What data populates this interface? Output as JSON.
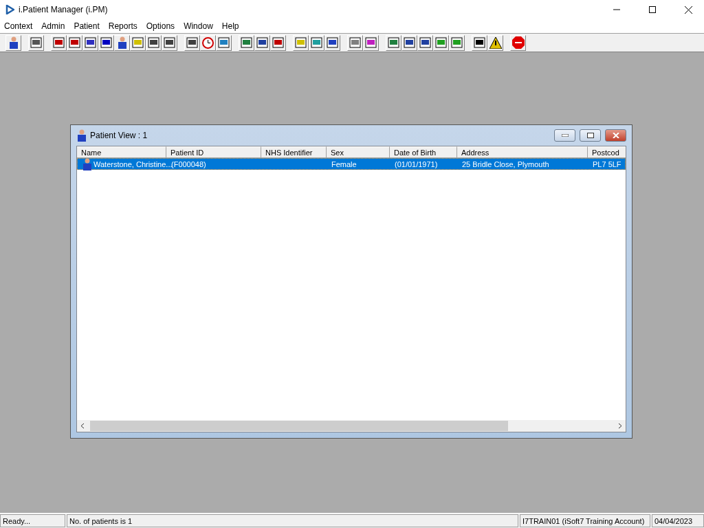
{
  "window": {
    "title": "i.Patient Manager (i.PM)"
  },
  "menu": [
    "Context",
    "Admin",
    "Patient",
    "Reports",
    "Options",
    "Window",
    "Help"
  ],
  "child_window": {
    "title": "Patient View : 1",
    "columns": [
      "Name",
      "Patient ID",
      "NHS Identifier",
      "Sex",
      "Date of Birth",
      "Address",
      "Postcod"
    ],
    "rows": [
      {
        "selected": true,
        "cells": [
          "Waterstone, Christine...",
          "(F000048)",
          "",
          "Female",
          "(01/01/1971)",
          "25 Bridle Close, Plymouth",
          "PL7 5LF"
        ]
      }
    ]
  },
  "status_bar": [
    "Ready...",
    "No. of patients is 1",
    "I7TRAIN01 (iSoft7 Training Account)",
    "04/04/2023"
  ]
}
